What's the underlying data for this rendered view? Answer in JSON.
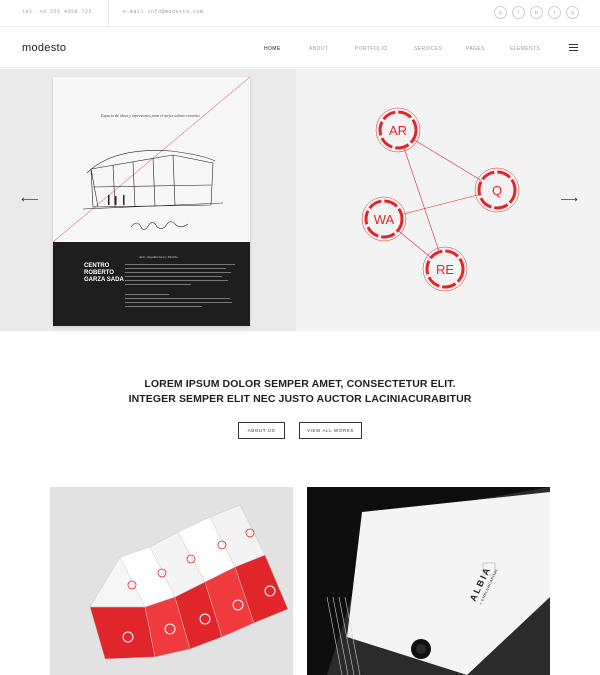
{
  "topbar": {
    "tel": "tel. +3 555 4358 725",
    "email": "e-mail info@modesto.com",
    "socials": [
      {
        "icon": "instagram-icon",
        "glyph": "◎"
      },
      {
        "icon": "facebook-icon",
        "glyph": "f"
      },
      {
        "icon": "pinterest-icon",
        "glyph": "p"
      },
      {
        "icon": "twitter-icon",
        "glyph": "t"
      },
      {
        "icon": "googleplus-icon",
        "glyph": "g"
      }
    ]
  },
  "nav": {
    "logo": "modesto",
    "items": [
      "HOME",
      "ABOUT",
      "PORTFOLIO",
      "SERVICES",
      "PAGES",
      "ELEMENTS"
    ],
    "active": "HOME"
  },
  "slider": {
    "poster": {
      "tagline": "Espacio de ideas y expresiones para el mejor talento creativo.",
      "signature": "Centro Roberto Garza Sada",
      "name": "CENTRO ROBERTO GARZA SADA",
      "subtitle": "Arte, Arquitectura y Diseño"
    },
    "graphic_labels": [
      "AR",
      "Q",
      "WA",
      "RE"
    ],
    "accent": "#e0262b"
  },
  "intro": {
    "line1": "LOREM IPSUM DOLOR SEMPER AMET, CONSECTETUR ELIT.",
    "line2": "INTEGER SEMPER ELIT NEC JUSTO AUCTOR LACINIACURABITUR",
    "about_button": "ABOUT US",
    "works_button": "VIEW ALL WORKS"
  },
  "gallery": {
    "right_brand": "ALBIA",
    "right_sub": "+ EMBLEMCAPITAL"
  }
}
